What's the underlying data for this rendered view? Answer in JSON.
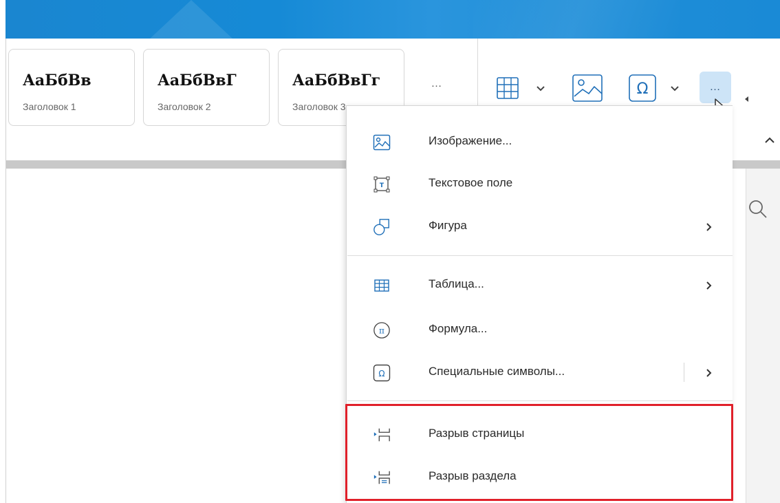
{
  "ribbon": {
    "styles": [
      {
        "sample": "АаБбВв",
        "caption": "Заголовок 1"
      },
      {
        "sample": "АаБбВвГ",
        "caption": "Заголовок 2"
      },
      {
        "sample": "АаБбВвГг",
        "caption": "Заголовок 3"
      }
    ],
    "more_styles": "…",
    "more_tools": "…",
    "icons": {
      "table": "table-icon",
      "image": "image-icon",
      "special_symbol": "omega-icon",
      "more": "more-icon",
      "collapse": "chevron-up-icon",
      "search": "search-icon"
    }
  },
  "menu": {
    "items": [
      {
        "label": "Изображение...",
        "icon": "image-icon",
        "has_submenu": false
      },
      {
        "label": "Текстовое поле",
        "icon": "text-box-icon",
        "has_submenu": false
      },
      {
        "label": "Фигура",
        "icon": "shape-icon",
        "has_submenu": true
      },
      {
        "label": "Таблица...",
        "icon": "table-icon",
        "has_submenu": true
      },
      {
        "label": "Формула...",
        "icon": "formula-icon",
        "has_submenu": false
      },
      {
        "label": "Специальные символы...",
        "icon": "omega-icon",
        "has_submenu": true
      },
      {
        "label": "Разрыв страницы",
        "icon": "page-break-icon",
        "has_submenu": false
      },
      {
        "label": "Разрыв раздела",
        "icon": "section-break-icon",
        "has_submenu": false
      }
    ]
  },
  "colors": {
    "title_bar": "#1a86d0",
    "highlight": "#e0202a",
    "active_button": "#cde4f7",
    "icon_blue": "#1f6fb8"
  }
}
